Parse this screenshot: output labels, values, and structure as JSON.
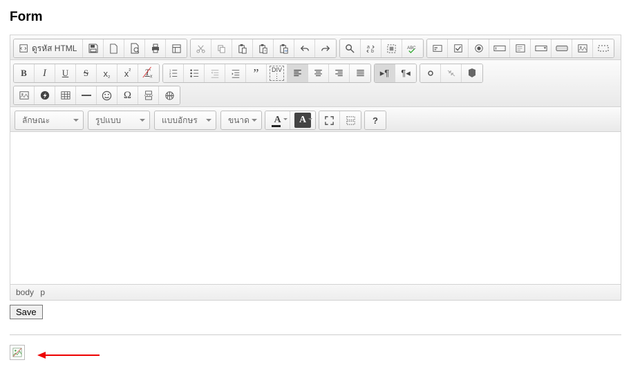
{
  "title": "Form",
  "source_label": "ดูรหัส HTML",
  "combos": {
    "style": "ลักษณะ",
    "format": "รูปแบบ",
    "font": "แบบอักษร",
    "size": "ขนาด"
  },
  "path": {
    "body": "body",
    "p": "p"
  },
  "save": "Save",
  "help": "?"
}
